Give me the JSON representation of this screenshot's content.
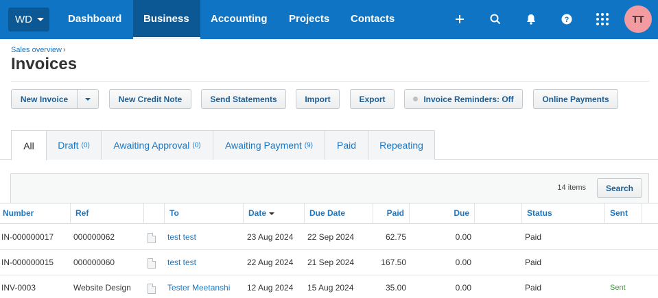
{
  "topnav": {
    "org_label": "WD",
    "items": [
      "Dashboard",
      "Business",
      "Accounting",
      "Projects",
      "Contacts"
    ],
    "active": "Business",
    "icons": [
      "plus-icon",
      "search-icon",
      "bell-icon",
      "help-icon",
      "apps-grid-icon"
    ],
    "avatar_initials": "TT",
    "colors": {
      "bar": "#1074c4",
      "active": "#0b5894",
      "avatar": "#f29ba0"
    }
  },
  "header": {
    "breadcrumb": "Sales overview",
    "breadcrumb_sep": "›",
    "title": "Invoices"
  },
  "toolbar": {
    "new_invoice": "New Invoice",
    "new_credit_note": "New Credit Note",
    "send_statements": "Send Statements",
    "import": "Import",
    "export": "Export",
    "invoice_reminders": "Invoice Reminders: Off",
    "online_payments": "Online Payments"
  },
  "tabs": [
    {
      "label": "All",
      "count": ""
    },
    {
      "label": "Draft",
      "count": "(0)"
    },
    {
      "label": "Awaiting Approval",
      "count": "(0)"
    },
    {
      "label": "Awaiting Payment",
      "count": "(9)"
    },
    {
      "label": "Paid",
      "count": ""
    },
    {
      "label": "Repeating",
      "count": ""
    }
  ],
  "search": {
    "items_count": "14 items",
    "button": "Search"
  },
  "table": {
    "columns": {
      "number": "Number",
      "ref": "Ref",
      "to": "To",
      "date": "Date",
      "due_date": "Due Date",
      "paid": "Paid",
      "due": "Due",
      "status": "Status",
      "sent": "Sent"
    },
    "rows": [
      {
        "number": "IN-000000017",
        "ref": "000000062",
        "to": "test test",
        "date": "23 Aug 2024",
        "due_date": "22 Sep 2024",
        "paid": "62.75",
        "due": "0.00",
        "status": "Paid",
        "sent": ""
      },
      {
        "number": "IN-000000015",
        "ref": "000000060",
        "to": "test test",
        "date": "22 Aug 2024",
        "due_date": "21 Sep 2024",
        "paid": "167.50",
        "due": "0.00",
        "status": "Paid",
        "sent": ""
      },
      {
        "number": "INV-0003",
        "ref": "Website Design",
        "to": "Tester Meetanshi",
        "date": "12 Aug 2024",
        "due_date": "15 Aug 2024",
        "paid": "35.00",
        "due": "0.00",
        "status": "Paid",
        "sent": "Sent"
      }
    ]
  }
}
